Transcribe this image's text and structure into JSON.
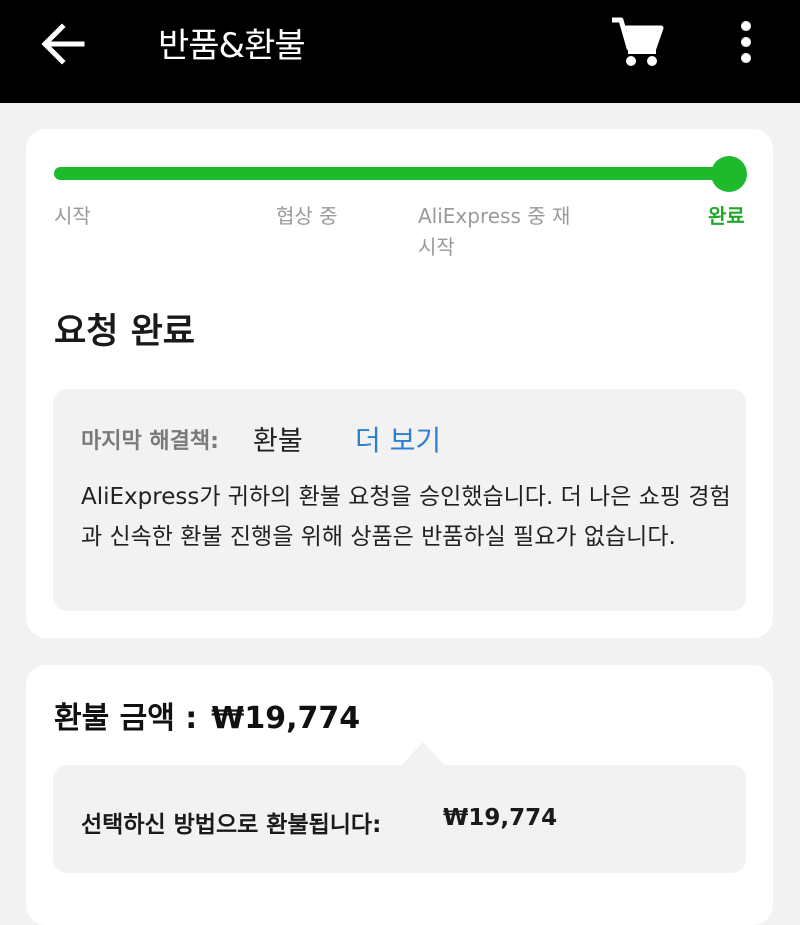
{
  "header": {
    "title": "반품&환불",
    "back_icon": "arrow-left-icon",
    "cart_icon": "shopping-cart-icon",
    "more_icon": "more-vertical-icon"
  },
  "progress": {
    "level": 1.0,
    "color": "#1fba2b",
    "steps": [
      {
        "label": "시작",
        "active": false
      },
      {
        "label": "협상 중",
        "active": false
      },
      {
        "label": "AliExpress 중 재 시작",
        "active": false
      },
      {
        "label": "완료",
        "active": true
      }
    ]
  },
  "status": {
    "title": "요청 완료"
  },
  "resolution": {
    "label": "마지막 해결책:",
    "value": "환불",
    "more_link": "더 보기",
    "description": "AliExpress가 귀하의 환불 요청을 승인했습니다. 더 나은 쇼핑 경험과 신속한 환불 진행을 위해 상품은 반품하실 필요가 없습니다."
  },
  "refund": {
    "title_label": "환불 금액 :",
    "amount": "₩19,774",
    "method_label": "선택하신 방법으로 환불됩니다:",
    "method_amount": "₩19,774"
  },
  "colors": {
    "accent_green": "#1fba2b",
    "link_blue": "#2d7fd2"
  }
}
